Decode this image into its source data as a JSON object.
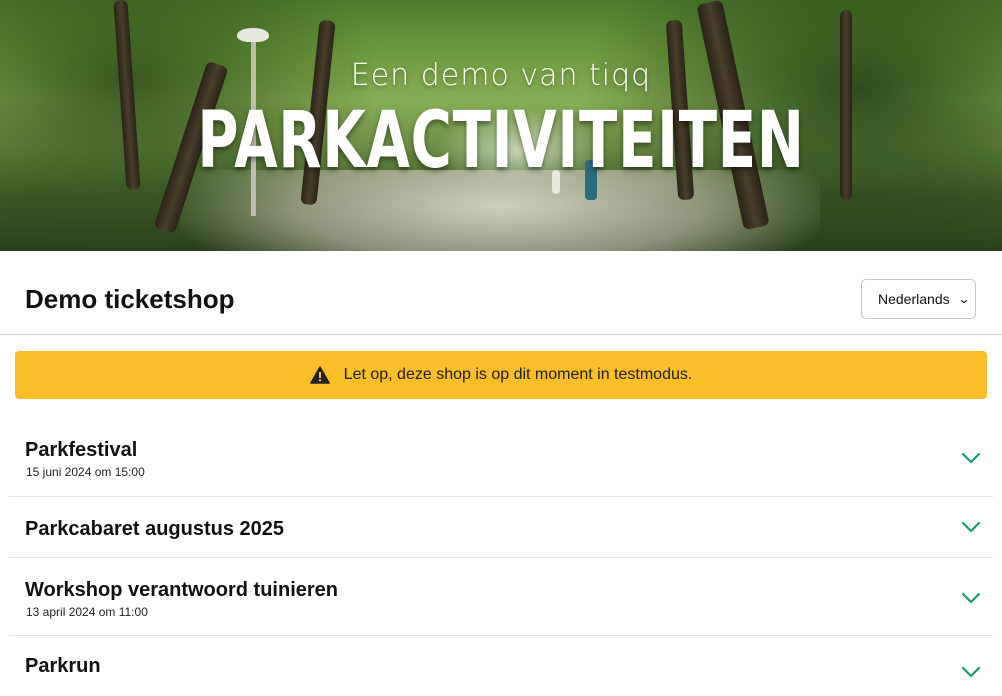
{
  "hero": {
    "subtitle": "Een demo van tiqq",
    "title": "PARKACTIVITEITEN"
  },
  "header": {
    "shop_title": "Demo ticketshop",
    "language": {
      "selected": "Nederlands",
      "icon": "chevron-down-icon"
    }
  },
  "alert": {
    "text": "Let op, deze shop is op dit moment in testmodus.",
    "icon": "warning-triangle-icon",
    "color": "#f9be28"
  },
  "events": [
    {
      "name": "Parkfestival",
      "date": "15 juni 2024 om 15:00"
    },
    {
      "name": "Parkcabaret augustus 2025",
      "date": ""
    },
    {
      "name": "Workshop verantwoord tuinieren",
      "date": "13 april 2024 om 11:00"
    },
    {
      "name": "Parkrun",
      "date": ""
    }
  ],
  "colors": {
    "accent_green": "#1a9a6c",
    "alert_yellow": "#f9be28"
  }
}
